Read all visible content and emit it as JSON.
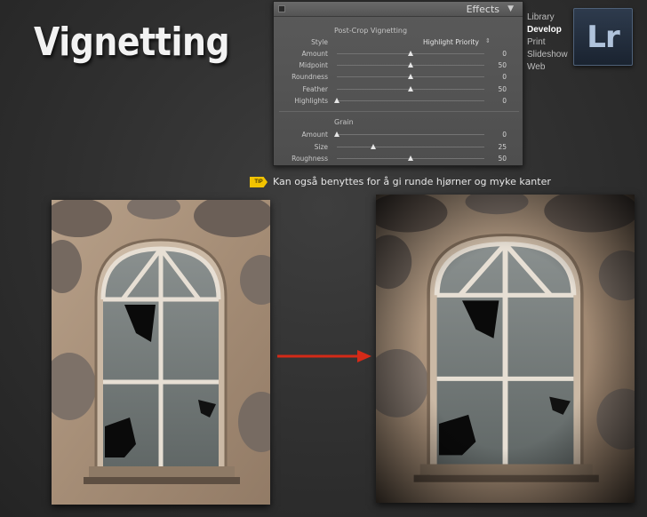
{
  "slide": {
    "title": "Vignetting"
  },
  "panel": {
    "title": "Effects",
    "post_crop": {
      "title": "Post-Crop Vignetting",
      "style_label": "Style",
      "style_value": "Highlight Priority",
      "sliders": [
        {
          "label": "Amount",
          "value": "0",
          "position": 0.5
        },
        {
          "label": "Midpoint",
          "value": "50",
          "position": 0.5
        },
        {
          "label": "Roundness",
          "value": "0",
          "position": 0.5
        },
        {
          "label": "Feather",
          "value": "50",
          "position": 0.5
        },
        {
          "label": "Highlights",
          "value": "0",
          "position": 0.0
        }
      ]
    },
    "grain": {
      "title": "Grain",
      "sliders": [
        {
          "label": "Amount",
          "value": "0",
          "position": 0.0
        },
        {
          "label": "Size",
          "value": "25",
          "position": 0.25
        },
        {
          "label": "Roughness",
          "value": "50",
          "position": 0.5
        }
      ]
    }
  },
  "modules": [
    "Library",
    "Develop",
    "Print",
    "Slideshow",
    "Web"
  ],
  "active_module": "Develop",
  "logo": {
    "text": "Lr"
  },
  "tip": {
    "badge": "TIP",
    "text": "Kan også benyttes for å gi runde hjørner og myke kanter"
  },
  "colors": {
    "accent_arrow": "#d42a18",
    "tip_badge": "#f2c300",
    "background": "#333333"
  },
  "icons": {
    "arrow": "arrow-right-icon",
    "panel_collapse": "triangle-down-icon"
  }
}
